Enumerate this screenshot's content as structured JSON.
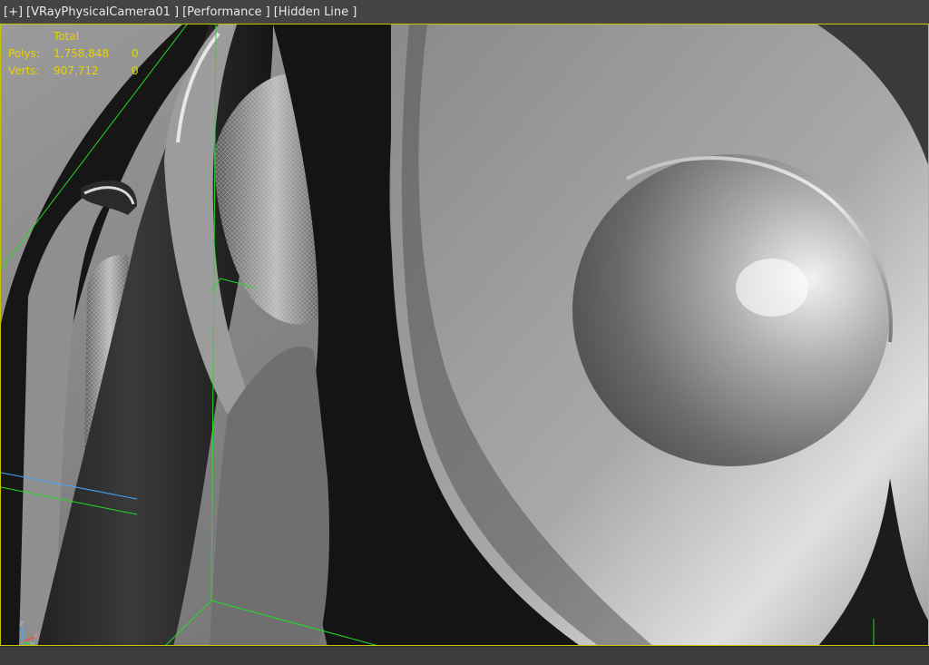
{
  "viewport": {
    "labels": [
      "[+]",
      "[VRayPhysicalCamera01 ]",
      "[Performance ]",
      "[Hidden Line ]"
    ],
    "stats": {
      "header": "Total",
      "rows": [
        {
          "label": "Polys:",
          "total": "1,758,848",
          "selected": "0"
        },
        {
          "label": "Verts:",
          "total": "907,712",
          "selected": "0"
        }
      ]
    },
    "axis": {
      "x": "x",
      "y": "y",
      "z": "z"
    },
    "colors": {
      "stats_text": "#e8d300",
      "border_active": "#c9c400",
      "bbox_line": "#22dd22",
      "axis_line": "#4aa3ff"
    }
  }
}
